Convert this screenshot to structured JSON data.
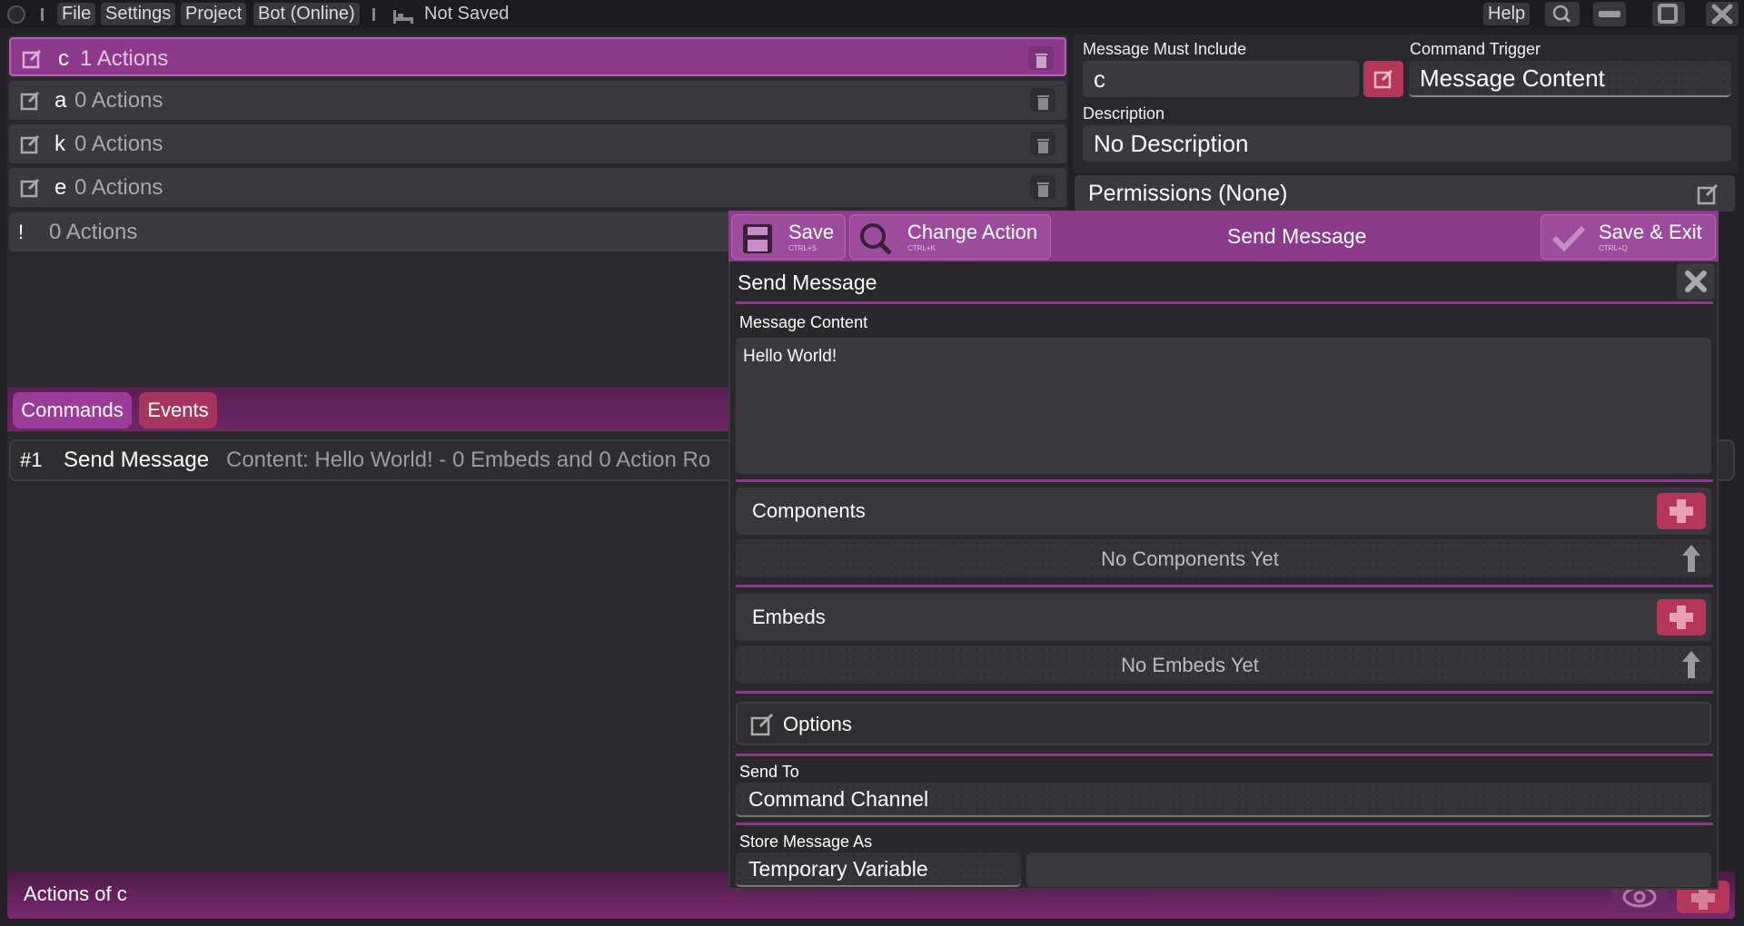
{
  "titlebar": {
    "menus": [
      "File",
      "Settings",
      "Project",
      "Bot (Online)"
    ],
    "status": "Not Saved",
    "help": "Help"
  },
  "commands": [
    {
      "name": "c",
      "count": "1 Actions",
      "selected": true
    },
    {
      "name": "a",
      "count": "0 Actions"
    },
    {
      "name": "k",
      "count": "0 Actions"
    },
    {
      "name": "e",
      "count": "0 Actions"
    },
    {
      "name": "!",
      "count": "0 Actions"
    }
  ],
  "tabs": {
    "commands": "Commands",
    "events": "Events"
  },
  "action_row": {
    "index": "#1",
    "name": "Send Message",
    "summary": "Content: Hello World! - 0 Embeds and 0 Action Ro"
  },
  "footer": {
    "title": "Actions of c"
  },
  "config": {
    "must_include_label": "Message Must Include",
    "must_include_value": "c",
    "trigger_label": "Command Trigger",
    "trigger_value": "Message Content",
    "description_label": "Description",
    "description_value": "No Description",
    "permissions": "Permissions (None)"
  },
  "editor": {
    "toolbar": {
      "save": "Save",
      "save_shortcut": "CTRL+S",
      "change": "Change Action",
      "change_shortcut": "CTRL+K",
      "title": "Send Message",
      "save_exit": "Save & Exit",
      "save_exit_shortcut": "CTRL+Q"
    },
    "action_name": "Send Message",
    "content_label": "Message Content",
    "content_value": "Hello World!",
    "components_label": "Components",
    "components_empty": "No Components Yet",
    "embeds_label": "Embeds",
    "embeds_empty": "No Embeds Yet",
    "options_label": "Options",
    "send_to_label": "Send To",
    "send_to_value": "Command Channel",
    "store_label": "Store Message As",
    "store_value": "Temporary Variable",
    "store_name": ""
  },
  "colors": {
    "accent": "#8c3b8c",
    "button_red": "#b5365a",
    "panel": "#3a3a3e",
    "background": "#222226"
  }
}
